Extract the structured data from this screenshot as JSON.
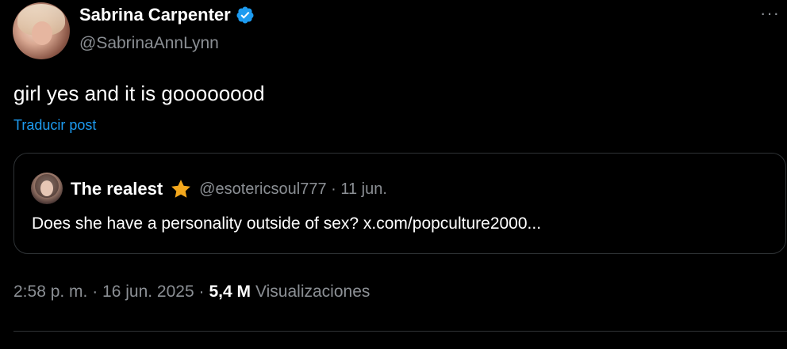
{
  "author": {
    "display_name": "Sabrina Carpenter",
    "handle": "@SabrinaAnnLynn",
    "verified_icon": "verified-badge-icon",
    "verified_color": "#1d9bf0"
  },
  "more_label": "···",
  "tweet": {
    "text": "girl yes and it is goooooood",
    "translate_label": "Traducir post"
  },
  "quoted": {
    "display_name": "The realest",
    "badge_icon": "star-icon",
    "badge_color": "#f4a81d",
    "handle_time": "@esotericsoul777 · 11 jun.",
    "text": "Does she have a personality outside of sex? x.com/popculture2000..."
  },
  "meta": {
    "timestamp": "2:58 p. m. · 16 jun. 2025 ·",
    "views_count": "5,4 M",
    "views_label": "Visualizaciones"
  },
  "colors": {
    "background": "#000000",
    "text_primary": "#ffffff",
    "text_secondary": "#8b8f94",
    "link": "#1d9bf0",
    "border": "#2f3336"
  }
}
